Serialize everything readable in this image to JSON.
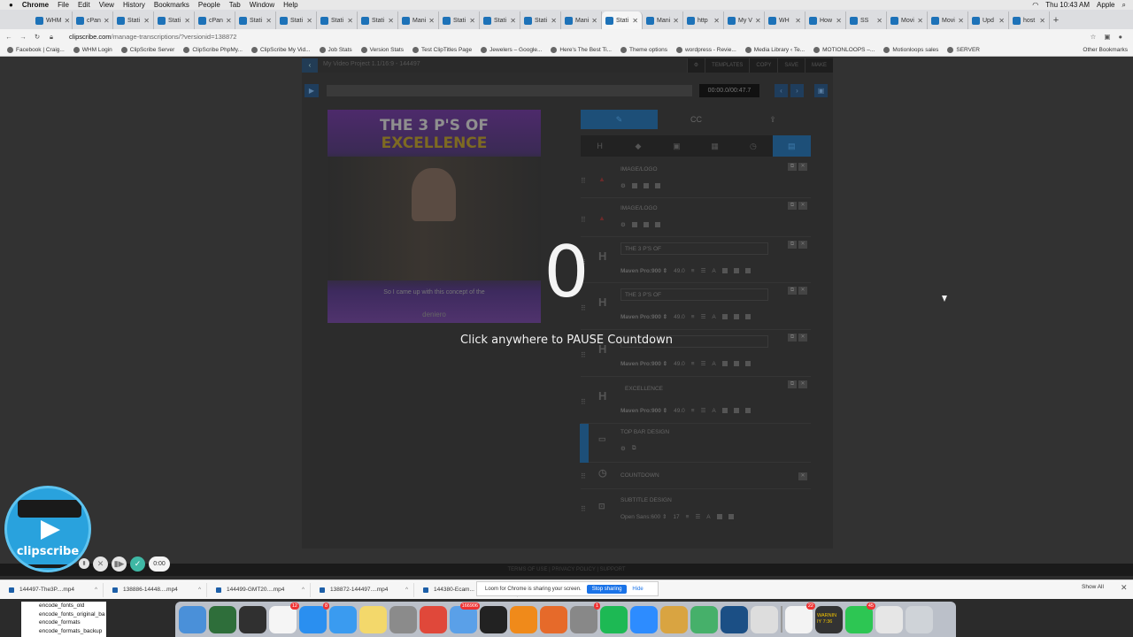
{
  "mac_menu": {
    "app": "Chrome",
    "items": [
      "File",
      "Edit",
      "View",
      "History",
      "Bookmarks",
      "People",
      "Tab",
      "Window",
      "Help"
    ],
    "clock": "Thu 10:43 AM",
    "user": "Apple"
  },
  "tabs": [
    {
      "label": "WHM"
    },
    {
      "label": "cPan"
    },
    {
      "label": "Stati"
    },
    {
      "label": "Stati"
    },
    {
      "label": "cPan"
    },
    {
      "label": "Stati"
    },
    {
      "label": "Stati"
    },
    {
      "label": "Stati"
    },
    {
      "label": "Stati"
    },
    {
      "label": "Mani"
    },
    {
      "label": "Stati"
    },
    {
      "label": "Stati"
    },
    {
      "label": "Stati"
    },
    {
      "label": "Mani"
    },
    {
      "label": "Stati"
    },
    {
      "label": "Mani"
    },
    {
      "label": "http"
    },
    {
      "label": "My V"
    },
    {
      "label": "WH"
    },
    {
      "label": "How"
    },
    {
      "label": "SS"
    },
    {
      "label": "Movi"
    },
    {
      "label": "Movi"
    },
    {
      "label": "Upd"
    },
    {
      "label": "host"
    }
  ],
  "address_bar": {
    "domain": "clipscribe.com",
    "path": "/manage-transcriptions/?versionid=138872"
  },
  "bookmarks": [
    "Facebook | Craig...",
    "WHM Login",
    "ClipScribe Server",
    "ClipScribe PhpMy...",
    "ClipScribe My Vid...",
    "Job Stats",
    "Version Stats",
    "Test ClipTitles Page",
    "Jewelers – Google...",
    "Here's The Best Ti...",
    "Theme options",
    "wordpress - Revie...",
    "Media Library ‹ Te...",
    "MOTIONLOOPS –...",
    "Motionloops sales",
    "SERVER"
  ],
  "other_bookmarks": "Other Bookmarks",
  "editor": {
    "back": "‹",
    "project_title": "My Video Project 1.1/16:9 - 144497",
    "toolbar": [
      "⚙",
      "TEMPLATES",
      "COPY",
      "SAVE",
      "MAKE"
    ],
    "timecode": "00:00.0/00:47.7",
    "play": "▶",
    "prev": "‹",
    "next": "›",
    "video": {
      "headline_1": "THE 3 P'S OF",
      "headline_2": "EXCELLENCE",
      "caption": "So I came up with this concept of the",
      "brand": "deniero"
    },
    "panel_tabs": [
      "✎",
      "CC",
      "⇪"
    ],
    "icon_row": [
      "H",
      "◆",
      "▣",
      "▦",
      "◷",
      "▤"
    ],
    "layers": [
      {
        "label": "IMAGE/LOGO"
      },
      {
        "label": "IMAGE/LOGO"
      },
      {
        "field": "THE 3 P'S OF",
        "font": "Maven Pro:900 ⇕",
        "size": "49.0"
      },
      {
        "field": "THE 3 P'S OF",
        "font": "Maven Pro:900 ⇕",
        "size": "49.0"
      },
      {
        "field": "",
        "font": "Maven Pro:900 ⇕",
        "size": "49.0"
      },
      {
        "field": "EXCELLENCE",
        "font": "Maven Pro:900 ⇕",
        "size": "49.0"
      },
      {
        "label": "TOP BAR DESIGN"
      },
      {
        "label": "COUNTDOWN"
      },
      {
        "label": "SUBTITLE DESIGN",
        "font": "Open Sans:600 ⇕",
        "size": "17"
      }
    ]
  },
  "countdown": {
    "value": "0",
    "hint": "Click anywhere to PAUSE Countdown"
  },
  "footer": "TERMS OF USE | PRIVACY POLICY | SUPPORT",
  "clipscribe_logo": {
    "word": "clipscribe"
  },
  "recorder": {
    "timer": "0:00"
  },
  "downloads": [
    "144497-The3P....mp4",
    "138886-14448....mp4",
    "144499-GMT20....mp4",
    "138872-144497....mp4",
    "144380-Ecam..."
  ],
  "share_banner": {
    "text": "Loom for Chrome is sharing your screen.",
    "stop": "Stop sharing",
    "hide": "Hide"
  },
  "show_all": "Show All",
  "finder_rows": [
    "encode_fonts_old",
    "encode_fonts_original_ba",
    "encode_formats",
    "encode_formats_backup"
  ],
  "dock": [
    {
      "name": "finder",
      "color": "#4a90d9"
    },
    {
      "name": "activity",
      "color": "#2e6e3a"
    },
    {
      "name": "obs",
      "color": "#303030"
    },
    {
      "name": "calendar",
      "color": "#f5f5f5",
      "badge": "12"
    },
    {
      "name": "app-store",
      "color": "#2a8ff0",
      "badge": "8"
    },
    {
      "name": "safari",
      "color": "#3a9bf0"
    },
    {
      "name": "notes",
      "color": "#f3d86b"
    },
    {
      "name": "calculator",
      "color": "#8b8b8b"
    },
    {
      "name": "chrome",
      "color": "#e0483a"
    },
    {
      "name": "mail",
      "color": "#5aa0e8",
      "badge": "166906"
    },
    {
      "name": "terminal",
      "color": "#222"
    },
    {
      "name": "vlc",
      "color": "#f08a1a"
    },
    {
      "name": "firefox",
      "color": "#e66a2a"
    },
    {
      "name": "system-preferences",
      "color": "#888",
      "badge": "1"
    },
    {
      "name": "spotify",
      "color": "#1db954"
    },
    {
      "name": "zoom",
      "color": "#2d8cff"
    },
    {
      "name": "transmit",
      "color": "#d9a441"
    },
    {
      "name": "atom",
      "color": "#46b06a"
    },
    {
      "name": "quicktime",
      "color": "#1b4f85"
    },
    {
      "name": "textedit",
      "color": "#ddd"
    },
    {
      "name": "reminders",
      "color": "#f3f3f3",
      "badge": "22"
    },
    {
      "name": "warnings",
      "color": "#333"
    },
    {
      "name": "facetime",
      "color": "#2dc653",
      "badge": "45"
    },
    {
      "name": "documents",
      "color": "#e6e6e6"
    },
    {
      "name": "trash",
      "color": "#cfd3d8"
    }
  ],
  "dock_warning_text": "WARNIN\nIY 7:36"
}
